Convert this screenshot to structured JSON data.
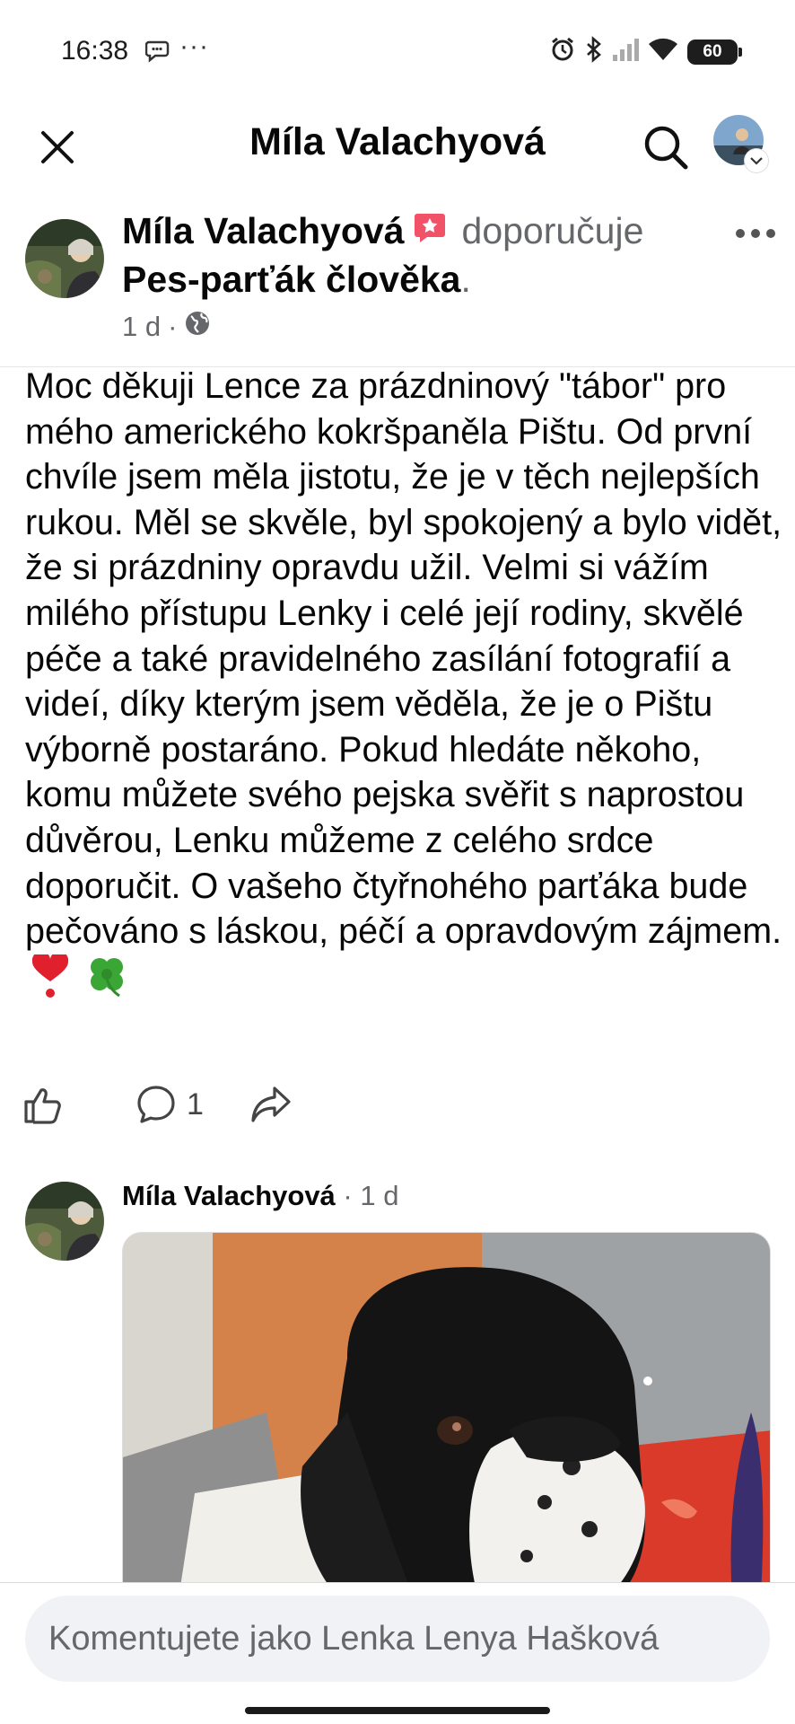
{
  "status_bar": {
    "time": "16:38",
    "more": "···",
    "battery": "60",
    "icons": [
      "chat-bubble-icon",
      "alarm-icon",
      "bluetooth-icon",
      "signal-icon",
      "wifi-icon",
      "battery-icon"
    ]
  },
  "header": {
    "title": "Míla Valachyová",
    "icons": [
      "close-icon",
      "search-icon",
      "avatar",
      "chevron-down-icon"
    ]
  },
  "post": {
    "author": "Míla Valachyová",
    "recommends": "doporučuje",
    "page_name": "Pes-parťák člověka",
    "page_suffix": ".",
    "time": "1 d",
    "separator": "·",
    "visibility_icon": "globe-icon",
    "more_icon": "more-horizontal-icon",
    "body": "Moc děkuji Lence za prázdninový \"tábor\" pro mého amerického kokršpaněla Pištu. Od první chvíle jsem měla jistotu, že je v těch nejlepších rukou. Měl se skvěle, byl spokojený a bylo vidět, že si prázdniny opravdu užil. Velmi si vážím milého přístupu Lenky i celé její rodiny, skvělé péče a také pravidelného zasílání fotografií a videí, díky kterým jsem věděla, že je o Pištu výborně postaráno. Pokud hledáte někoho, komu můžete svého pejska svěřit s naprostou důvěrou, Lenku můžeme z celého srdce doporučit. O vašeho čtyřnohého parťáka bude pečováno s láskou, péčí a opravdovým zájmem.",
    "emojis": [
      "heart-emoji-icon",
      "clover-emoji-icon"
    ],
    "actions": {
      "like_icon": "thumbs-up-icon",
      "comment_icon": "comment-icon",
      "comment_count": "1",
      "share_icon": "share-icon"
    }
  },
  "comment": {
    "author": "Míla Valachyová",
    "time": " · 1 d",
    "photo": "dog-photo"
  },
  "composer": {
    "placeholder": "Komentujete jako Lenka Lenya Hašková"
  },
  "colors": {
    "text": "#080809",
    "secondary": "#65676b",
    "input_bg": "#f0f2f5",
    "badge": "#f25268"
  }
}
